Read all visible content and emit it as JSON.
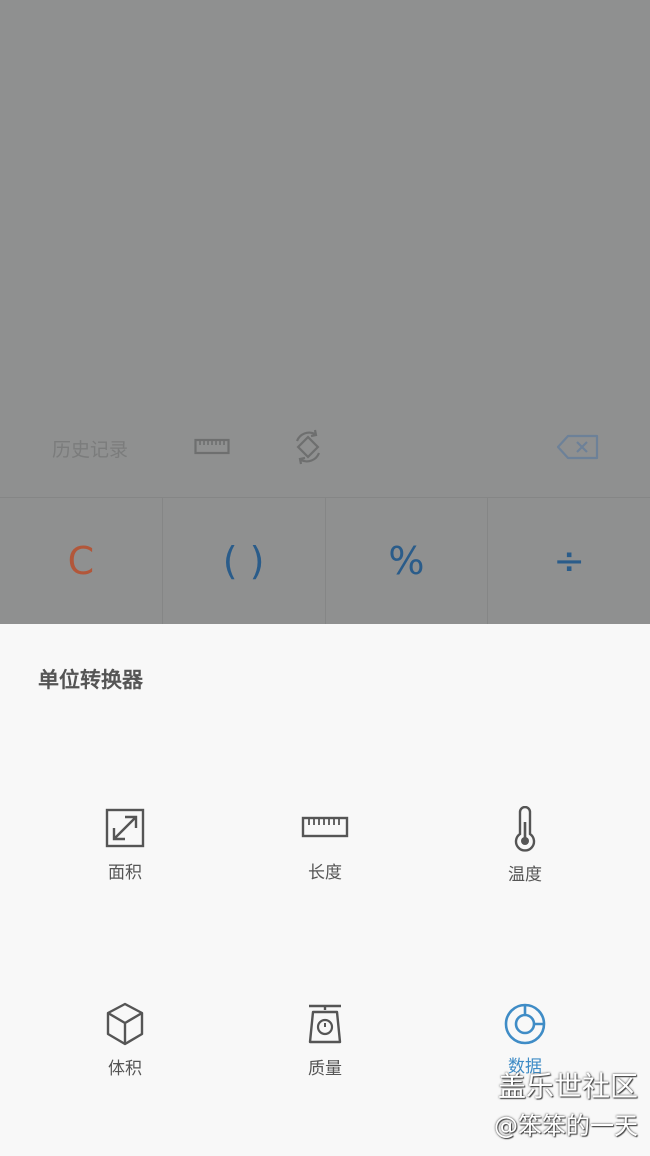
{
  "toolbar": {
    "history_label": "历史记录"
  },
  "keys": {
    "clear": "C",
    "paren": "( )",
    "percent": "%",
    "divide": "÷"
  },
  "sheet": {
    "title": "单位转换器",
    "items": [
      {
        "label": "面积",
        "icon": "area-icon"
      },
      {
        "label": "长度",
        "icon": "ruler-icon"
      },
      {
        "label": "温度",
        "icon": "thermometer-icon"
      },
      {
        "label": "体积",
        "icon": "cube-icon"
      },
      {
        "label": "质量",
        "icon": "scale-icon"
      },
      {
        "label": "数据",
        "icon": "data-icon"
      }
    ],
    "active_color": "#3f8cc6"
  },
  "watermark": {
    "line1": "盖乐世社区",
    "line2": "@笨笨的一天"
  }
}
